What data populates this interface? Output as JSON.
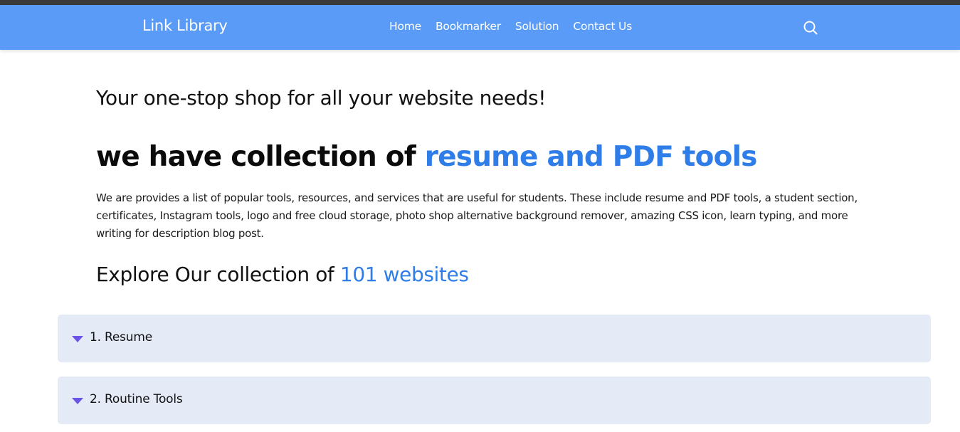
{
  "header": {
    "brand": "Link Library",
    "nav": [
      "Home",
      "Bookmarker",
      "Solution",
      "Contact Us"
    ],
    "search_icon": "search-icon"
  },
  "hero": {
    "tagline": "Your one-stop shop for all your website needs!",
    "headline_prefix": "we have collection of ",
    "headline_accent": "resume and PDF tools",
    "description": "We are provides a list of popular tools, resources, and services that are useful for students. These include resume and PDF tools, a student section, certificates, Instagram tools, logo and free cloud storage, photo shop alternative background remover, amazing CSS icon, learn typing, and more writing for description blog post.",
    "explore_prefix": "Explore Our collection of ",
    "explore_accent": "101 websites"
  },
  "accordion": {
    "items": [
      {
        "label": "1. Resume"
      },
      {
        "label": "2. Routine Tools"
      }
    ],
    "arrow_icon": "caret-down-icon"
  },
  "colors": {
    "navbar": "#5a9bf7",
    "accent": "#2f7de8",
    "accordion_bg": "#e4ebf7",
    "caret": "#6b53e8"
  }
}
